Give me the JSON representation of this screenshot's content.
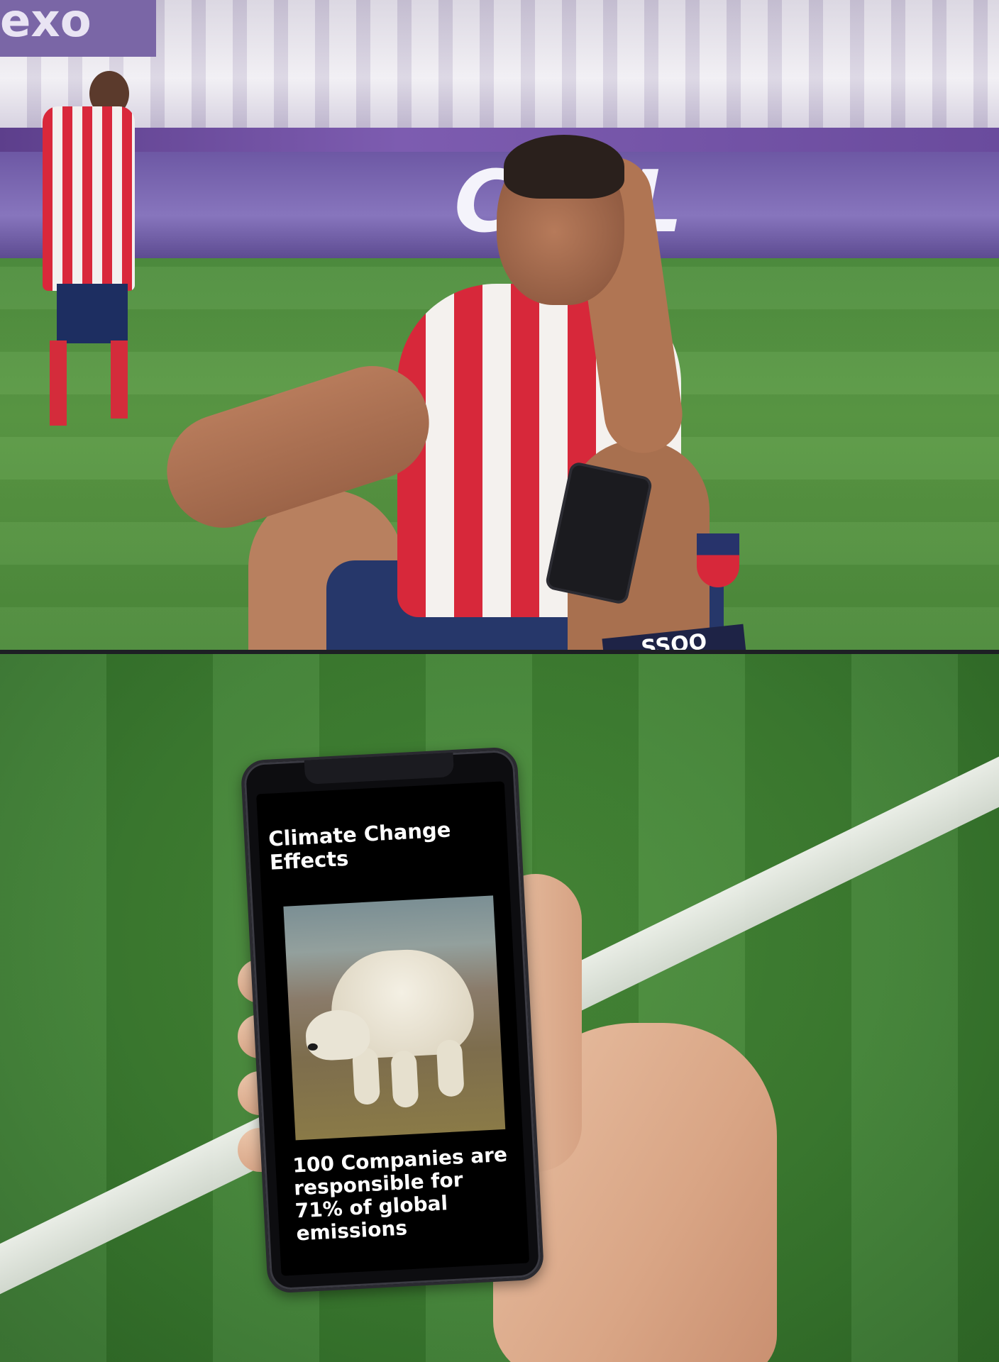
{
  "top_panel": {
    "stadium_sign": "exo",
    "ad_board_text": "CEL",
    "sponsor_text": "SSOO"
  },
  "phone_screen": {
    "headline": "Climate Change Effects",
    "photo_subject": "polar-bear",
    "caption": "100 Companies are responsible for 71% of global emissions"
  },
  "colors": {
    "pitch_green": "#4f8f3f",
    "ad_board_purple": "#6d58a4",
    "jersey_red": "#d7283a",
    "jersey_white": "#f4f1ee",
    "screen_bg": "#000000",
    "screen_text": "#ffffff"
  }
}
